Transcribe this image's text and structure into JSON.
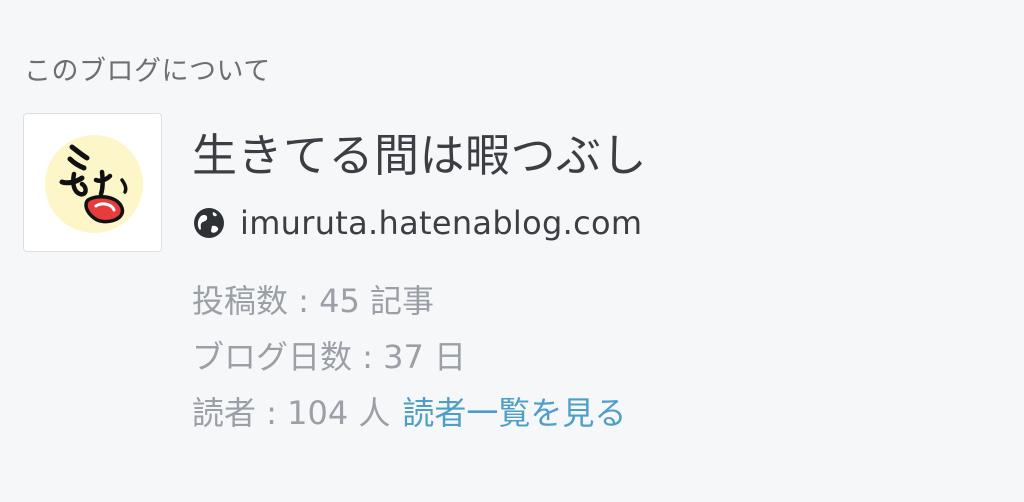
{
  "about": {
    "heading": "このブログについて",
    "avatar_icon": "blog-avatar-face",
    "title": "生きてる間は暇つぶし",
    "url_icon": "globe-icon",
    "url": "imuruta.hatenablog.com",
    "stats": {
      "posts": "投稿数 : 45 記事",
      "days": "ブログ日数 : 37 日",
      "readers": "読者 : 104 人",
      "readers_link": "読者一覧を見る"
    }
  },
  "colors": {
    "background": "#f6f7f9",
    "title_text": "#3b3f44",
    "muted_text": "#9aa0a6",
    "link": "#4e9fc7",
    "avatar_bg": "#fdf6c8",
    "avatar_mouth": "#e63c3c"
  }
}
